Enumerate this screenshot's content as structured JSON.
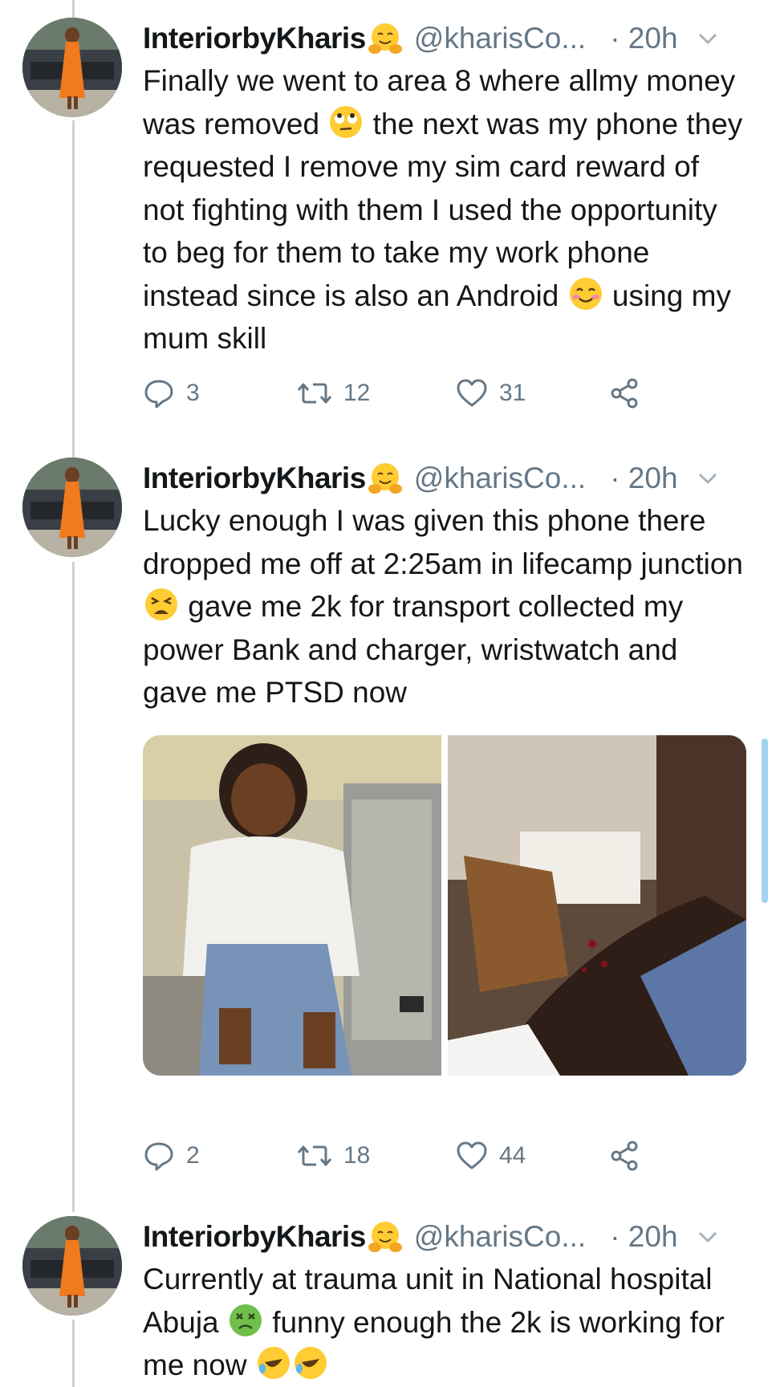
{
  "tweets": [
    {
      "display_name": "InteriorbyKharis",
      "name_emoji": "hugging-face-emoji",
      "handle": "@kharisCo...",
      "time": "· 20h",
      "text_parts": [
        "Finally we went to area 8 where allmy money was removed ",
        " the next was my phone they requested I remove my sim card reward of not fighting with them I used the opportunity to beg for them to take my work phone instead since is also an Android ",
        " using my mum skill"
      ],
      "emojis": [
        "rolling-eyes-emoji",
        "smiling-blush-emoji"
      ],
      "actions": {
        "replies": "3",
        "retweets": "12",
        "likes": "31"
      }
    },
    {
      "display_name": "InteriorbyKharis",
      "name_emoji": "hugging-face-emoji",
      "handle": "@kharisCo...",
      "time": "· 20h",
      "text_parts": [
        "Lucky enough I was given this phone there dropped me off at 2:25am in lifecamp junction ",
        " gave me 2k for transport collected my power Bank and charger, wristwatch and gave me PTSD now"
      ],
      "emojis": [
        "tired-face-emoji"
      ],
      "media": [
        "photo-woman-seated-bench",
        "photo-injured-leg"
      ],
      "actions": {
        "replies": "2",
        "retweets": "18",
        "likes": "44"
      }
    },
    {
      "display_name": "InteriorbyKharis",
      "name_emoji": "hugging-face-emoji",
      "handle": "@kharisCo...",
      "time": "· 20h",
      "text_parts": [
        "Currently at trauma unit in National hospital Abuja ",
        " funny enough the 2k is working for me now "
      ],
      "emojis": [
        "nauseated-face-emoji",
        "rolling-laughing-emoji"
      ]
    }
  ],
  "colors": {
    "text": "#14171a",
    "secondary": "#657786",
    "thread_line": "#c8d2da",
    "accent": "#1da1f2"
  }
}
